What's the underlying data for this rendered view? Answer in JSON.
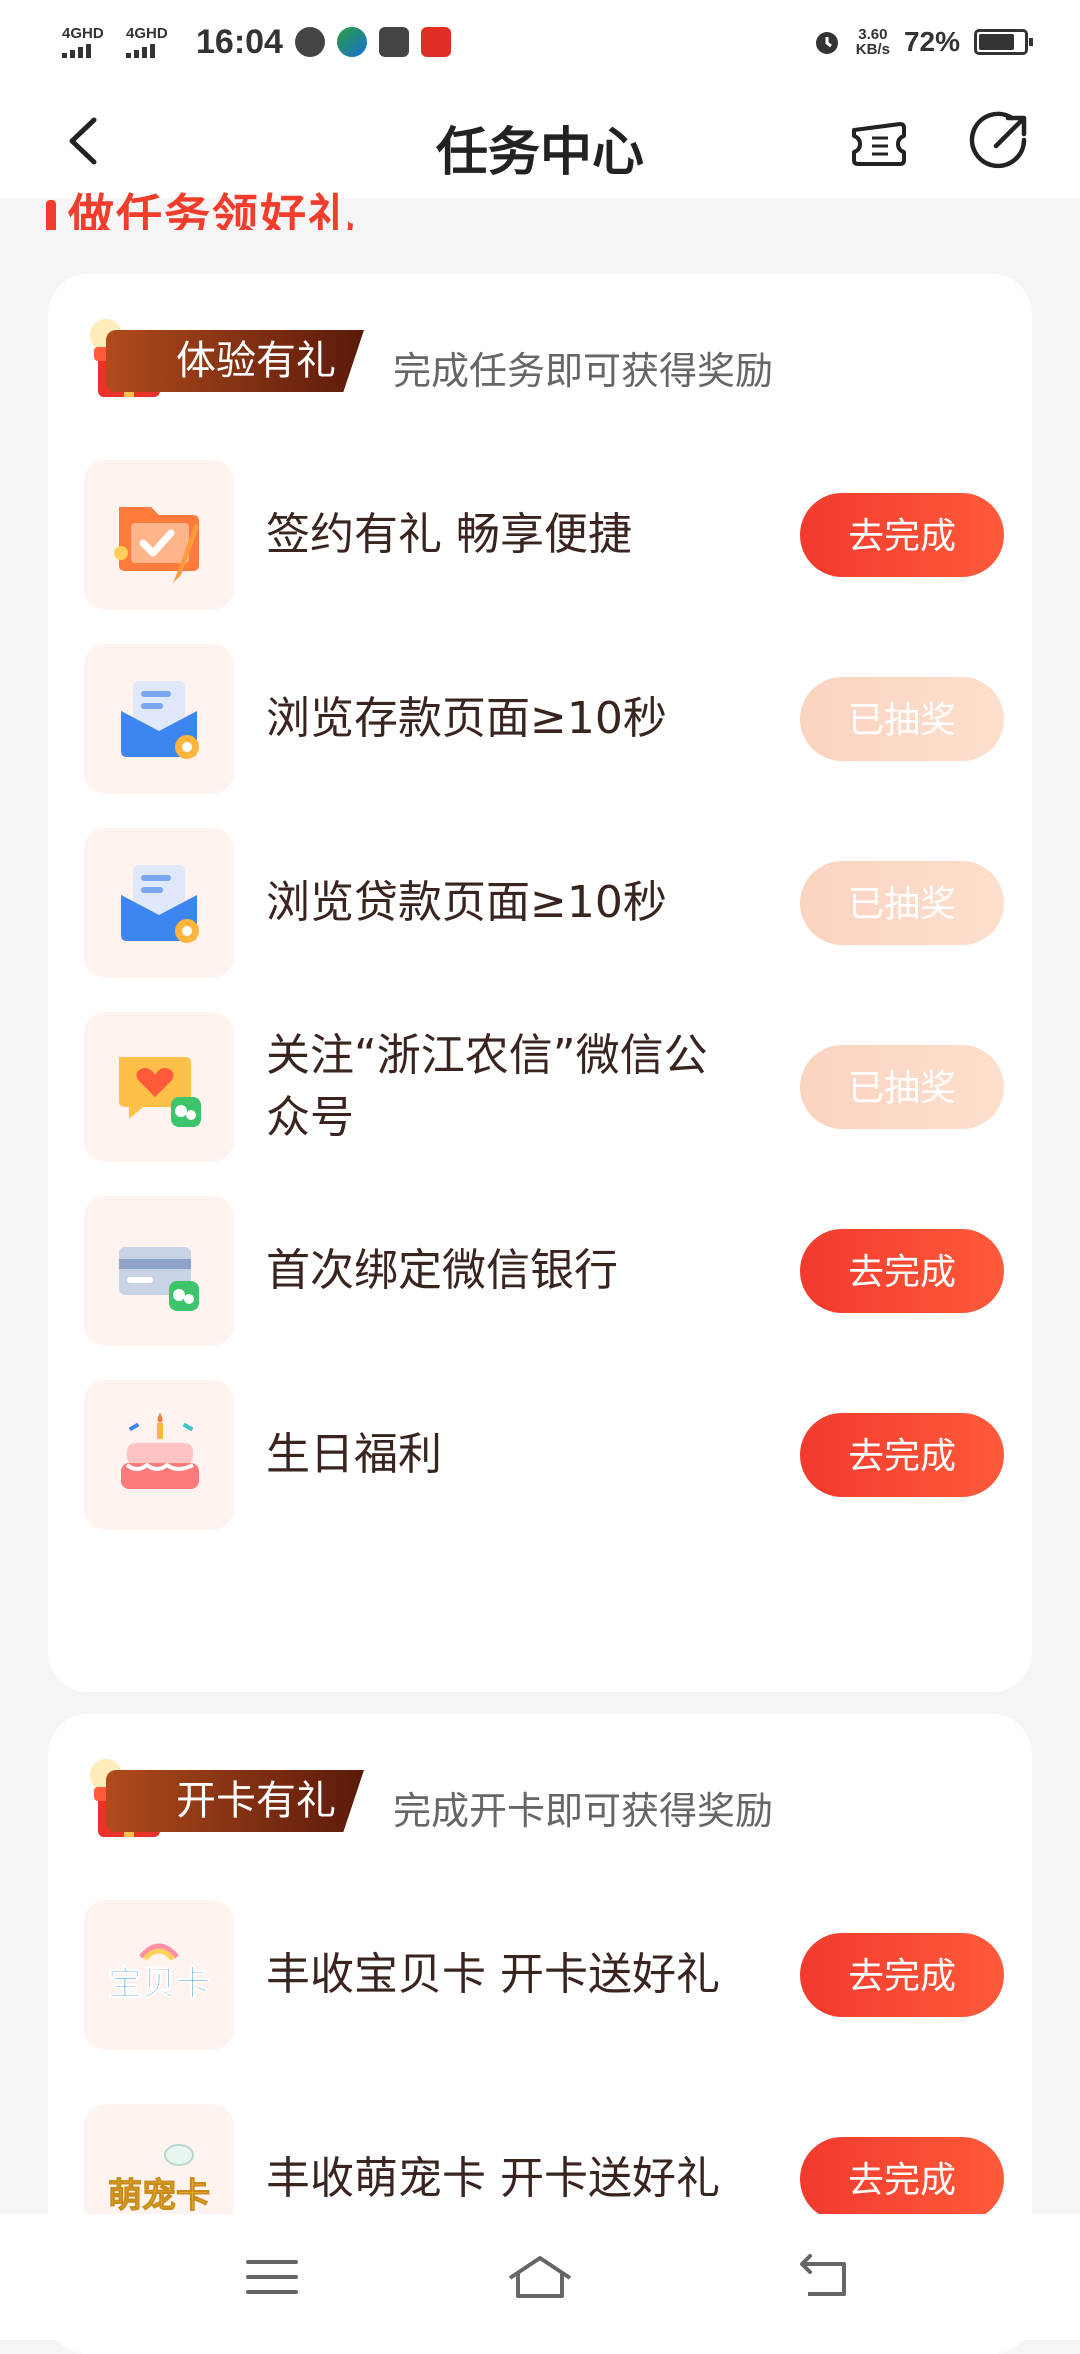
{
  "status_bar": {
    "signal1": "4GHD",
    "signal2": "4GHD",
    "time": "16:04",
    "speed_value": "3.60",
    "speed_unit": "KB/s",
    "battery_pct": "72%",
    "battery_level": 0.72
  },
  "header": {
    "title": "任务中心",
    "back_icon": "chevron-left-icon",
    "ticket_icon": "ticket-icon",
    "share_icon": "share-icon"
  },
  "section_title": "做任务领好礼",
  "experience": {
    "tag": "体验有礼",
    "desc": "完成任务即可获得奖励",
    "tasks": [
      {
        "label": "签约有礼 畅享便捷",
        "button": "去完成",
        "icon": "folder-sign-icon",
        "done": false
      },
      {
        "label": "浏览存款页面≥10秒",
        "button": "已抽奖",
        "icon": "mail-view-icon",
        "done": true
      },
      {
        "label": "浏览贷款页面≥10秒",
        "button": "已抽奖",
        "icon": "mail-view-icon",
        "done": true
      },
      {
        "label": "关注“浙江农信”微信公众号",
        "button": "已抽奖",
        "icon": "wechat-heart-icon",
        "done": true
      },
      {
        "label": "首次绑定微信银行",
        "button": "去完成",
        "icon": "card-wechat-icon",
        "done": false
      },
      {
        "label": "生日福利",
        "button": "去完成",
        "icon": "cake-icon",
        "done": false
      }
    ]
  },
  "card_open": {
    "tag": "开卡有礼",
    "desc": "完成开卡即可获得奖励",
    "tasks": [
      {
        "label": "丰收宝贝卡 开卡送好礼",
        "button": "去完成",
        "icon_text": "宝贝卡"
      },
      {
        "label": "丰收萌宠卡 开卡送好礼",
        "button": "去完成",
        "icon_text": "萌宠卡"
      }
    ]
  },
  "navbar": {
    "menu_icon": "menu-icon",
    "home_icon": "home-icon",
    "back_icon": "back-arrow-icon"
  },
  "colors": {
    "accent": "#f23d2c",
    "done_button": "#fcd9c6",
    "tag_bg": "#8b2c10"
  }
}
